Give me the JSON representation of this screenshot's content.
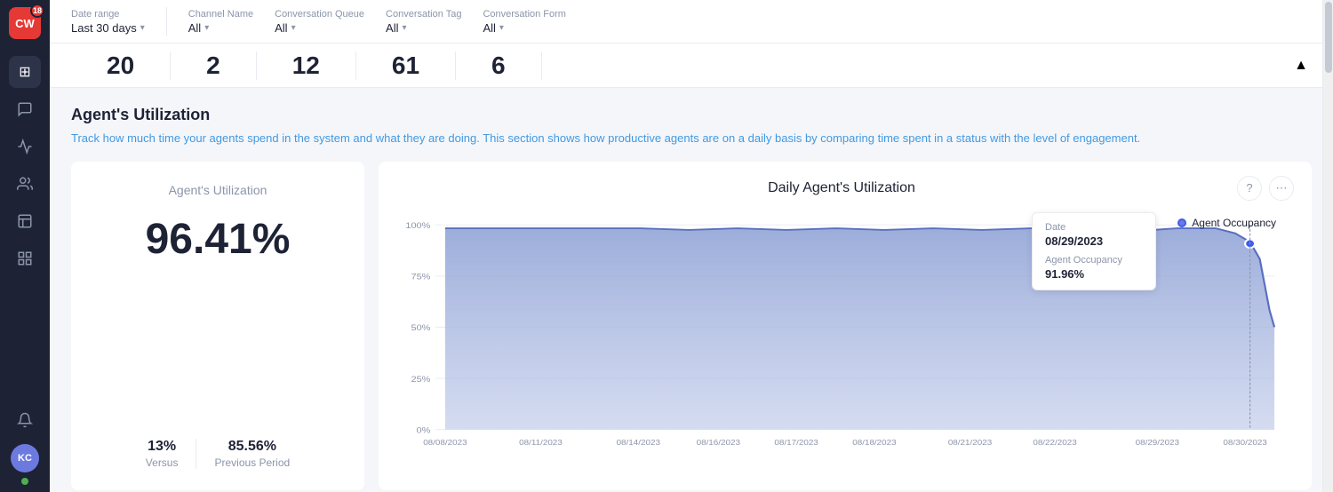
{
  "sidebar": {
    "logo_text": "CW",
    "badge_count": "18",
    "items": [
      {
        "name": "dashboard",
        "icon": "⊞"
      },
      {
        "name": "conversations",
        "icon": "💬"
      },
      {
        "name": "analytics",
        "icon": "📈"
      },
      {
        "name": "contacts",
        "icon": "👥"
      },
      {
        "name": "reports",
        "icon": "📋"
      },
      {
        "name": "table-view",
        "icon": "⊟"
      }
    ],
    "avatar_text": "KC",
    "online_status": "online"
  },
  "filters": {
    "date_range_label": "Date range",
    "date_range_value": "Last 30 days",
    "channel_name_label": "Channel Name",
    "channel_name_value": "All",
    "conversation_queue_label": "Conversation Queue",
    "conversation_queue_value": "All",
    "conversation_tag_label": "Conversation Tag",
    "conversation_tag_value": "All",
    "conversation_form_label": "Conversation Form",
    "conversation_form_value": "All"
  },
  "top_numbers": {
    "number1": "20",
    "number2": "2",
    "number3": "12",
    "number4": "61",
    "number5": "6"
  },
  "section": {
    "title": "Agent's Utilization",
    "description_start": "Track how much time your agents spend in the system and what they are doing.",
    "description_highlight": "This section shows how productive agents are on a daily basis by comparing time spent in a status with the level of engagement."
  },
  "left_panel": {
    "title": "Agent's Utilization",
    "main_value": "96.41%",
    "versus_value": "13%",
    "versus_label": "Versus",
    "previous_value": "85.56%",
    "previous_label": "Previous Period"
  },
  "right_panel": {
    "title": "Daily Agent's Utilization",
    "help_label": "?",
    "more_label": "⋯",
    "tooltip": {
      "date_label": "Date",
      "date_value": "08/29/2023",
      "metric_label": "Agent Occupancy",
      "metric_value": "91.96%"
    },
    "legend": {
      "label": "Agent Occupancy"
    },
    "x_axis": [
      "08/08/2023",
      "08/11/2023",
      "08/14/2023",
      "08/16/2023",
      "08/17/2023",
      "08/18/2023",
      "08/21/2023",
      "08/22/2023",
      "08/29/2023",
      "08/30/2023"
    ],
    "y_axis": [
      "100%",
      "75%",
      "50%",
      "25%",
      "0%"
    ]
  }
}
